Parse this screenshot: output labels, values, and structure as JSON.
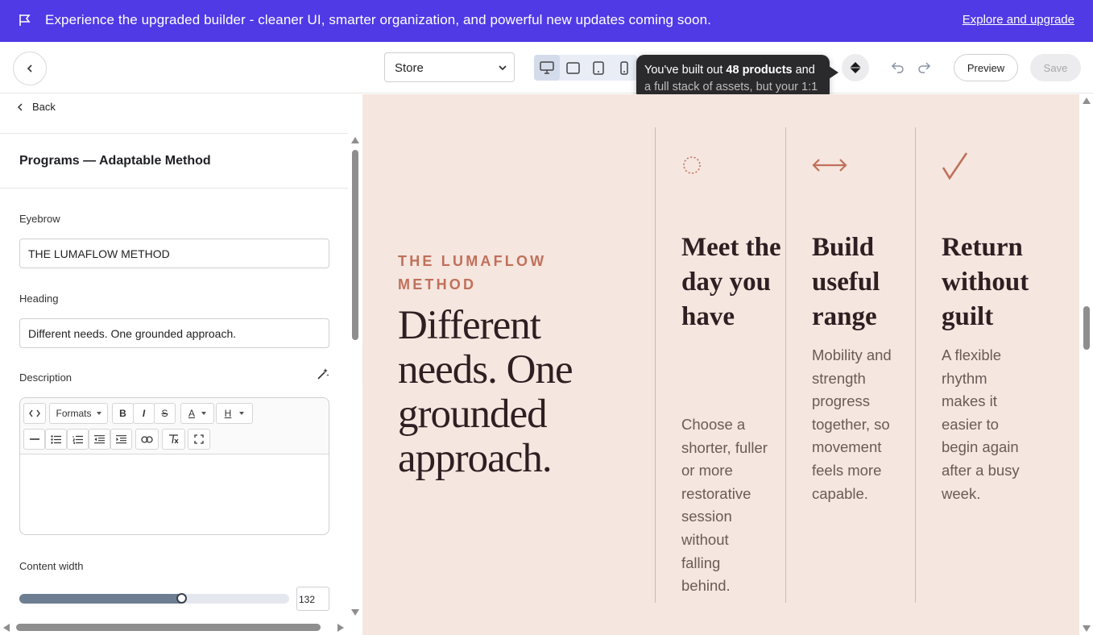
{
  "banner": {
    "message": "Experience the upgraded builder - cleaner UI, smarter organization, and powerful new updates coming soon.",
    "link": "Explore and upgrade"
  },
  "toolbar": {
    "store_select": "Store",
    "tooltip_line1_pre": "You've built out ",
    "tooltip_line1_bold": "48 products",
    "tooltip_line1_post": " and",
    "tooltip_line2": "a full stack of assets, but your 1:1",
    "preview": "Preview",
    "save": "Save"
  },
  "panel": {
    "back": "Back",
    "section_title": "Programs — Adaptable Method",
    "eyebrow_label": "Eyebrow",
    "eyebrow_value": "THE LUMAFLOW METHOD",
    "heading_label": "Heading",
    "heading_value": "Different needs. One grounded approach.",
    "description_label": "Description",
    "formats": "Formats",
    "content_width_label": "Content width",
    "content_width_value": "132",
    "content_width_fraction": 0.6
  },
  "canvas": {
    "eyebrow": "THE LUMAFLOW METHOD",
    "heading": "Different needs. One grounded approach.",
    "columns": [
      {
        "icon": "dotted-circle-icon",
        "title": "Meet the day you have",
        "desc": "Choose a shorter, fuller or more restorative session without falling behind."
      },
      {
        "icon": "double-arrow-icon",
        "title": "Build useful range",
        "desc": "Mobility and strength progress together, so movement feels more capable."
      },
      {
        "icon": "checkmark-icon",
        "title": "Return without guilt",
        "desc": "A flexible rhythm makes it easier to begin again after a busy week."
      }
    ]
  },
  "colors": {
    "banner": "#4f3ae6",
    "canvas_bg": "#f5e6df",
    "accent": "#c0705a",
    "heading": "#2d1f22"
  }
}
